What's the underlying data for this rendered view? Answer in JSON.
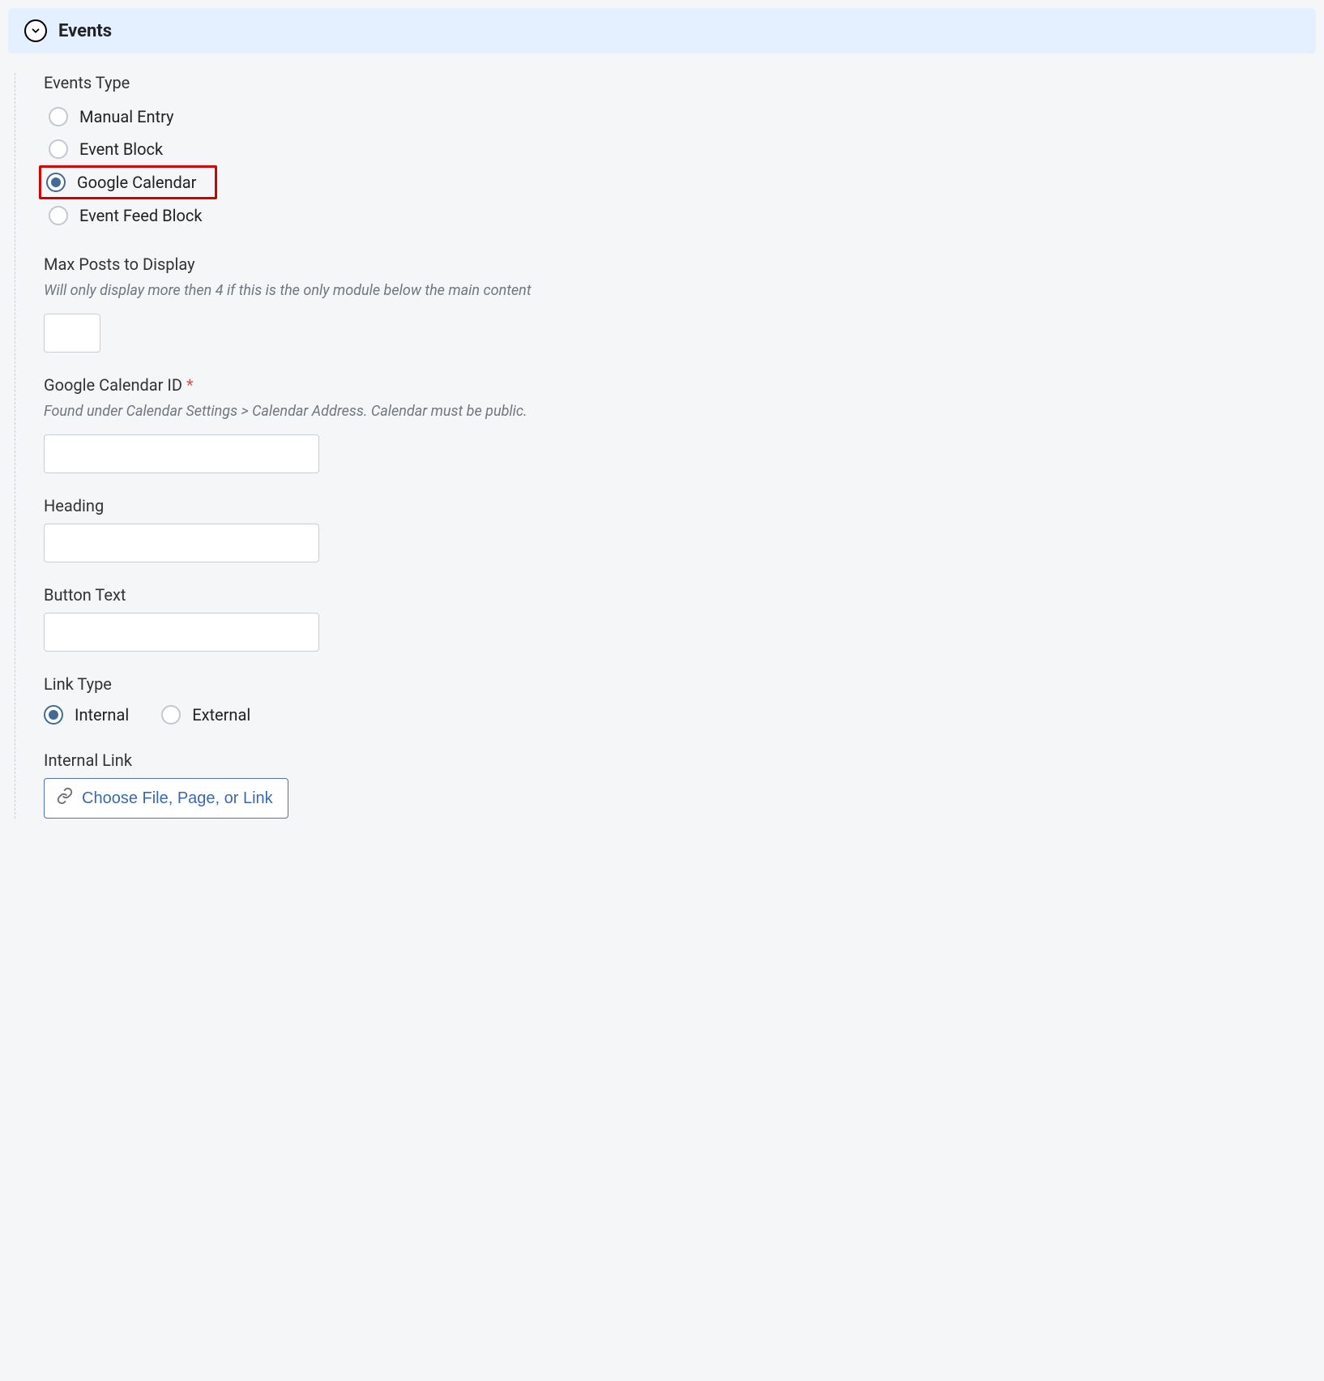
{
  "section": {
    "title": "Events"
  },
  "events_type": {
    "label": "Events Type",
    "options": [
      {
        "label": "Manual Entry"
      },
      {
        "label": "Event Block"
      },
      {
        "label": "Google Calendar"
      },
      {
        "label": "Event Feed Block"
      }
    ],
    "selected_index": 2
  },
  "max_posts": {
    "label": "Max Posts to Display",
    "help": "Will only display more then 4 if this is the only module below the main content",
    "value": ""
  },
  "calendar_id": {
    "label": "Google Calendar ID",
    "required_marker": "*",
    "help": "Found under Calendar Settings > Calendar Address. Calendar must be public.",
    "value": ""
  },
  "heading": {
    "label": "Heading",
    "value": ""
  },
  "button_text": {
    "label": "Button Text",
    "value": ""
  },
  "link_type": {
    "label": "Link Type",
    "options": [
      {
        "label": "Internal"
      },
      {
        "label": "External"
      }
    ],
    "selected_index": 0
  },
  "internal_link": {
    "label": "Internal Link",
    "chooser_label": "Choose File, Page, or Link"
  }
}
